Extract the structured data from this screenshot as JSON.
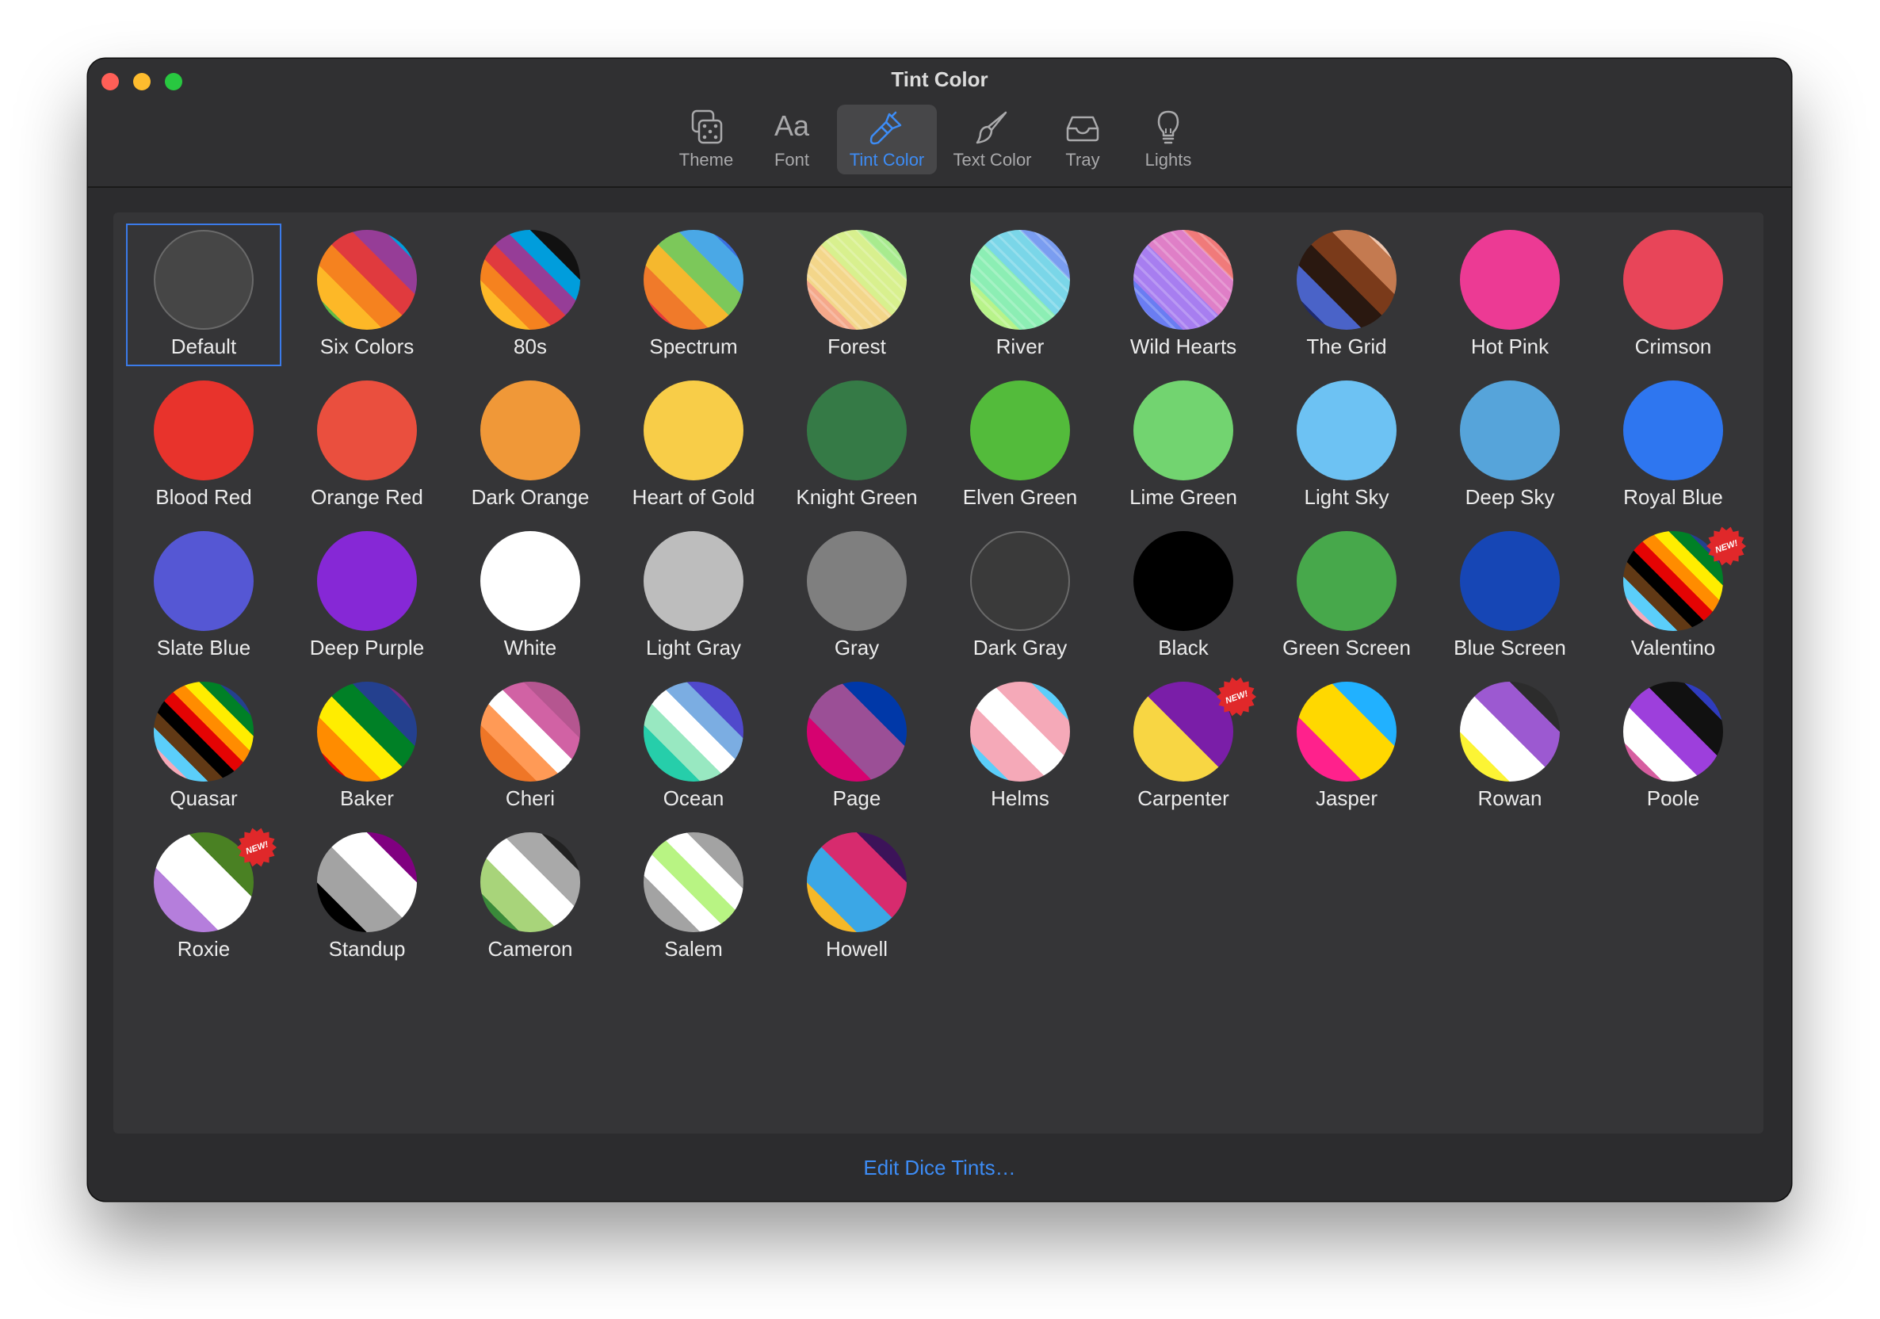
{
  "window": {
    "title": "Tint Color",
    "traffic_lights": [
      "#ff5f57",
      "#febc2e",
      "#28c840"
    ]
  },
  "toolbar": {
    "items": [
      {
        "label": "Theme",
        "icon": "dice-icon"
      },
      {
        "label": "Font",
        "icon": "font-icon",
        "glyph": "Aa"
      },
      {
        "label": "Tint Color",
        "icon": "paintbrush-icon",
        "selected": true
      },
      {
        "label": "Text Color",
        "icon": "brush-icon"
      },
      {
        "label": "Tray",
        "icon": "tray-icon"
      },
      {
        "label": "Lights",
        "icon": "lightbulb-icon"
      }
    ]
  },
  "badge_text": "NEW!",
  "tints": [
    {
      "name": "Default",
      "selected": true,
      "fill": "#464646",
      "ring": true
    },
    {
      "name": "Six Colors",
      "stripes": [
        "#61bb46",
        "#fdb827",
        "#f5821f",
        "#e03a3e",
        "#963d97",
        "#009ddc"
      ]
    },
    {
      "name": "80s",
      "stripes": [
        "#61bb46",
        "#fdb827",
        "#f5821f",
        "#e03a3e",
        "#963d97",
        "#009ddc",
        "#111111",
        "#bfbfbf"
      ]
    },
    {
      "name": "Spectrum",
      "stripes": [
        "#e63a3a",
        "#f07a2a",
        "#f5b82e",
        "#7cc85a",
        "#4aa8e6",
        "#3a6fe0"
      ]
    },
    {
      "name": "Forest",
      "stripes": [
        "#f5a88a",
        "#f3d68a",
        "#d8f08e",
        "#a8eb8e"
      ],
      "hatched": true
    },
    {
      "name": "River",
      "stripes": [
        "#b8f38a",
        "#8ceeb4",
        "#7ad6e8",
        "#7a9df0"
      ],
      "hatched": true
    },
    {
      "name": "Wild Hearts",
      "stripes": [
        "#6a7df2",
        "#a77ef0",
        "#df7fc7",
        "#f07a7a"
      ],
      "hatched": true
    },
    {
      "name": "The Grid",
      "stripes": [
        "#1e2a6e",
        "#4a63c8",
        "#2a1810",
        "#7a3a1a",
        "#c47a50",
        "#f0c8b0"
      ]
    },
    {
      "name": "Hot Pink",
      "fill": "#ec3a94"
    },
    {
      "name": "Crimson",
      "fill": "#e84559"
    },
    {
      "name": "Blood Red",
      "fill": "#e8332c"
    },
    {
      "name": "Orange Red",
      "fill": "#ea4f3e"
    },
    {
      "name": "Dark Orange",
      "fill": "#f09838"
    },
    {
      "name": "Heart of Gold",
      "fill": "#f8cd48"
    },
    {
      "name": "Knight Green",
      "fill": "#357a46"
    },
    {
      "name": "Elven Green",
      "fill": "#53bb3b"
    },
    {
      "name": "Lime Green",
      "fill": "#72d470"
    },
    {
      "name": "Light Sky",
      "fill": "#6dc2f3"
    },
    {
      "name": "Deep Sky",
      "fill": "#56a4da"
    },
    {
      "name": "Royal Blue",
      "fill": "#2e76f0"
    },
    {
      "name": "Slate Blue",
      "fill": "#5557d4"
    },
    {
      "name": "Deep Purple",
      "fill": "#8628d6"
    },
    {
      "name": "White",
      "fill": "#ffffff"
    },
    {
      "name": "Light Gray",
      "fill": "#bdbdbd"
    },
    {
      "name": "Gray",
      "fill": "#7f7f7f"
    },
    {
      "name": "Dark Gray",
      "fill": "#3a3a3a",
      "ring": true
    },
    {
      "name": "Black",
      "fill": "#000000"
    },
    {
      "name": "Green Screen",
      "fill": "#47a84b"
    },
    {
      "name": "Blue Screen",
      "fill": "#1646b5"
    },
    {
      "name": "Valentino",
      "stripes": [
        "#ffffff",
        "#f5a9b8",
        "#5bcefa",
        "#613915",
        "#000000",
        "#e40303",
        "#ff8c00",
        "#ffed00",
        "#008026",
        "#24408e",
        "#732982"
      ],
      "is_new": true
    },
    {
      "name": "Quasar",
      "stripes": [
        "#ffffff",
        "#f5a9b8",
        "#5bcefa",
        "#613915",
        "#000000",
        "#e40303",
        "#ff8c00",
        "#ffed00",
        "#008026",
        "#24408e",
        "#732982"
      ]
    },
    {
      "name": "Baker",
      "stripes": [
        "#e40303",
        "#ff8c00",
        "#ffed00",
        "#008026",
        "#24408e",
        "#732982"
      ]
    },
    {
      "name": "Cheri",
      "stripes": [
        "#d52d00",
        "#ef7627",
        "#ff9a56",
        "#ffffff",
        "#d162a4",
        "#b55690",
        "#a30262"
      ]
    },
    {
      "name": "Ocean",
      "stripes": [
        "#078d70",
        "#26ceaa",
        "#98e8c1",
        "#ffffff",
        "#7bade2",
        "#5049cc",
        "#3d1a78"
      ]
    },
    {
      "name": "Page",
      "stripes": [
        "#d60270",
        "#9b4f96",
        "#0038a8"
      ]
    },
    {
      "name": "Helms",
      "stripes": [
        "#5bcefa",
        "#f5a9b8",
        "#ffffff",
        "#f5a9b8",
        "#5bcefa"
      ]
    },
    {
      "name": "Carpenter",
      "stripes": [
        "#f8d643",
        "#7a1ea8"
      ],
      "is_new": true
    },
    {
      "name": "Jasper",
      "stripes": [
        "#ff218c",
        "#ffd800",
        "#21b1ff"
      ]
    },
    {
      "name": "Rowan",
      "stripes": [
        "#fcf434",
        "#ffffff",
        "#9c59d1",
        "#2c2c2c"
      ]
    },
    {
      "name": "Poole",
      "stripes": [
        "#d65ea0",
        "#ffffff",
        "#9d3fdc",
        "#111111",
        "#2f3cbe"
      ]
    },
    {
      "name": "Roxie",
      "stripes": [
        "#b57edc",
        "#ffffff",
        "#4a8123"
      ],
      "is_new": true
    },
    {
      "name": "Standup",
      "stripes": [
        "#000000",
        "#a3a3a3",
        "#ffffff",
        "#800080"
      ]
    },
    {
      "name": "Cameron",
      "stripes": [
        "#3a8a3a",
        "#a8d47a",
        "#ffffff",
        "#a9a9a9",
        "#222222"
      ]
    },
    {
      "name": "Salem",
      "stripes": [
        "#222222",
        "#a3a3a3",
        "#ffffff",
        "#b8f483",
        "#ffffff",
        "#a3a3a3",
        "#222222"
      ]
    },
    {
      "name": "Howell",
      "stripes": [
        "#f6b828",
        "#3ba7e6",
        "#d72b6e",
        "#3c1359"
      ]
    }
  ],
  "footer": {
    "edit_link": "Edit Dice Tints…"
  }
}
